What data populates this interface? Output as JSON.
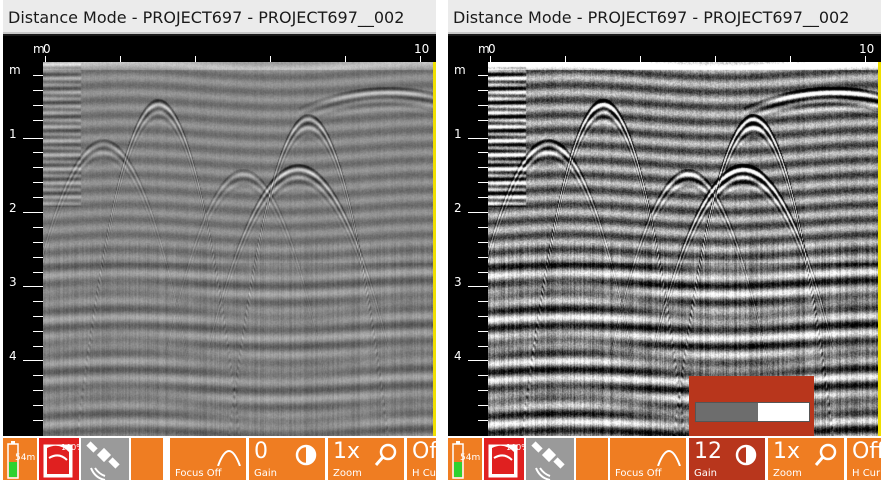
{
  "panels": [
    {
      "id": "left",
      "title": "Distance Mode - PROJECT697 - PROJECT697__002",
      "x_axis": {
        "unit": "m",
        "start_label": "0",
        "end_label": "10"
      },
      "y_axis": {
        "unit": "m",
        "labels": [
          "1",
          "2",
          "3",
          "4"
        ]
      },
      "status": {
        "battery_label": "54m",
        "storage_label": "100%",
        "gps_icon": "satellite-icon"
      },
      "toolbar": {
        "focus": {
          "label": "Focus Off",
          "icon": "curve-icon"
        },
        "gain": {
          "value": "0",
          "label": "Gain",
          "icon": "contrast-icon"
        },
        "zoom": {
          "value": "1x",
          "label": "Zoom",
          "icon": "magnifier-icon"
        },
        "hcursor": {
          "value": "Off",
          "label": "H Cur"
        }
      },
      "contrast": 1.0
    },
    {
      "id": "right",
      "title": "Distance Mode - PROJECT697 - PROJECT697__002",
      "x_axis": {
        "unit": "m",
        "start_label": "0",
        "end_label": "10"
      },
      "y_axis": {
        "unit": "m",
        "labels": [
          "1",
          "2",
          "3",
          "4"
        ]
      },
      "status": {
        "battery_label": "54m",
        "storage_label": "100%",
        "gps_icon": "satellite-icon"
      },
      "toolbar": {
        "focus": {
          "label": "Focus Off",
          "icon": "curve-icon"
        },
        "gain": {
          "value": "12",
          "label": "Gain",
          "icon": "contrast-icon"
        },
        "zoom": {
          "value": "1x",
          "label": "Zoom",
          "icon": "magnifier-icon"
        },
        "hcursor": {
          "value": "Off",
          "label": "H Cur"
        }
      },
      "contrast": 3.2,
      "gain_slider": {
        "level": 0.55
      }
    }
  ],
  "colors": {
    "accent": "#ef7d22",
    "popup": "#b8361c",
    "cursor": "#f0e000",
    "battery_green": "#2fd22f",
    "status_red": "#e02020"
  }
}
